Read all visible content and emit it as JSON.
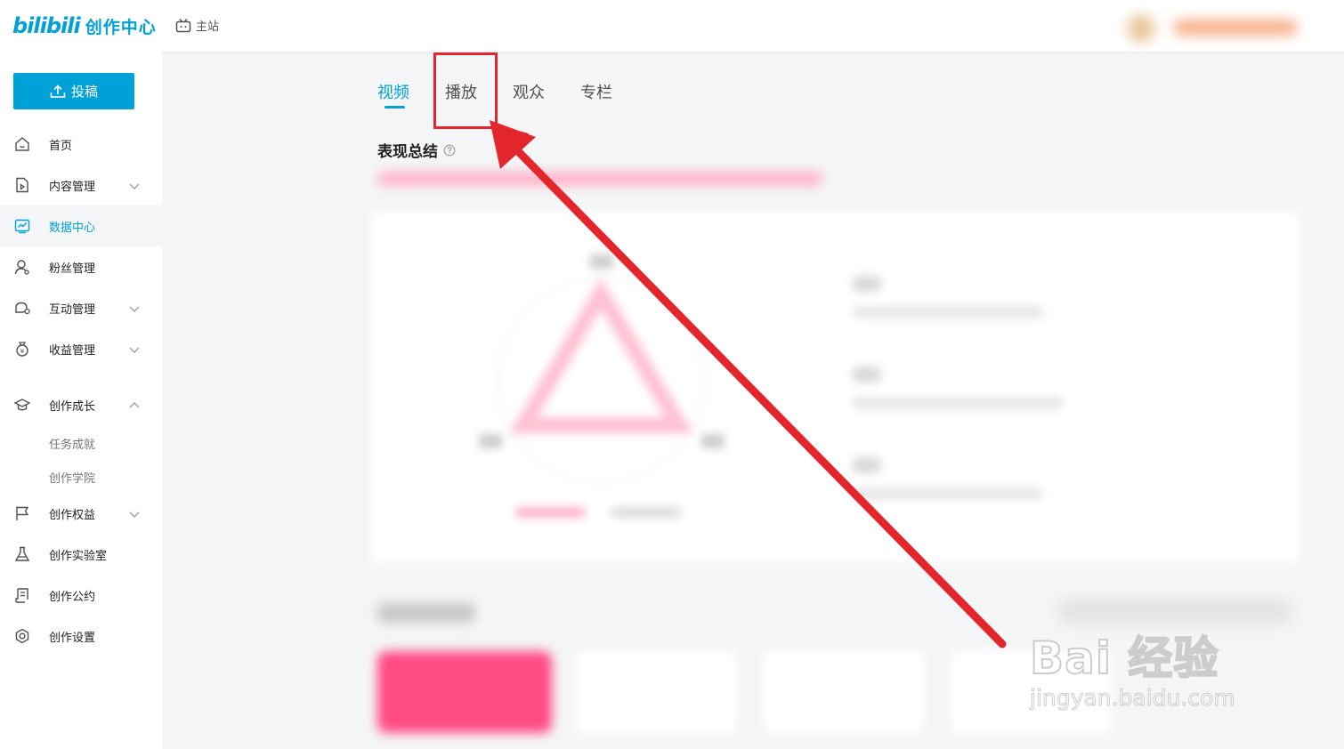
{
  "header": {
    "logo_brand": "bilibili",
    "logo_title": "创作中心",
    "main_site": "主站"
  },
  "sidebar": {
    "upload_label": "投稿",
    "items": [
      {
        "label": "首页"
      },
      {
        "label": "内容管理"
      },
      {
        "label": "数据中心"
      },
      {
        "label": "粉丝管理"
      },
      {
        "label": "互动管理"
      },
      {
        "label": "收益管理"
      },
      {
        "label": "创作成长"
      },
      {
        "label": "任务成就"
      },
      {
        "label": "创作学院"
      },
      {
        "label": "创作权益"
      },
      {
        "label": "创作实验室"
      },
      {
        "label": "创作公约"
      },
      {
        "label": "创作设置"
      }
    ],
    "active_index": 2
  },
  "tabs": [
    {
      "label": "视频"
    },
    {
      "label": "播放"
    },
    {
      "label": "观众"
    },
    {
      "label": "专栏"
    }
  ],
  "active_tab": "视频",
  "highlighted_tab": "播放",
  "section": {
    "title": "表现总结"
  },
  "colors": {
    "accent": "#00a1d6",
    "annotation": "#e3262c",
    "pink": "#ff4b84"
  },
  "watermark": {
    "line1": "Bai 经验",
    "line2": "jingyan.baidu.com"
  }
}
